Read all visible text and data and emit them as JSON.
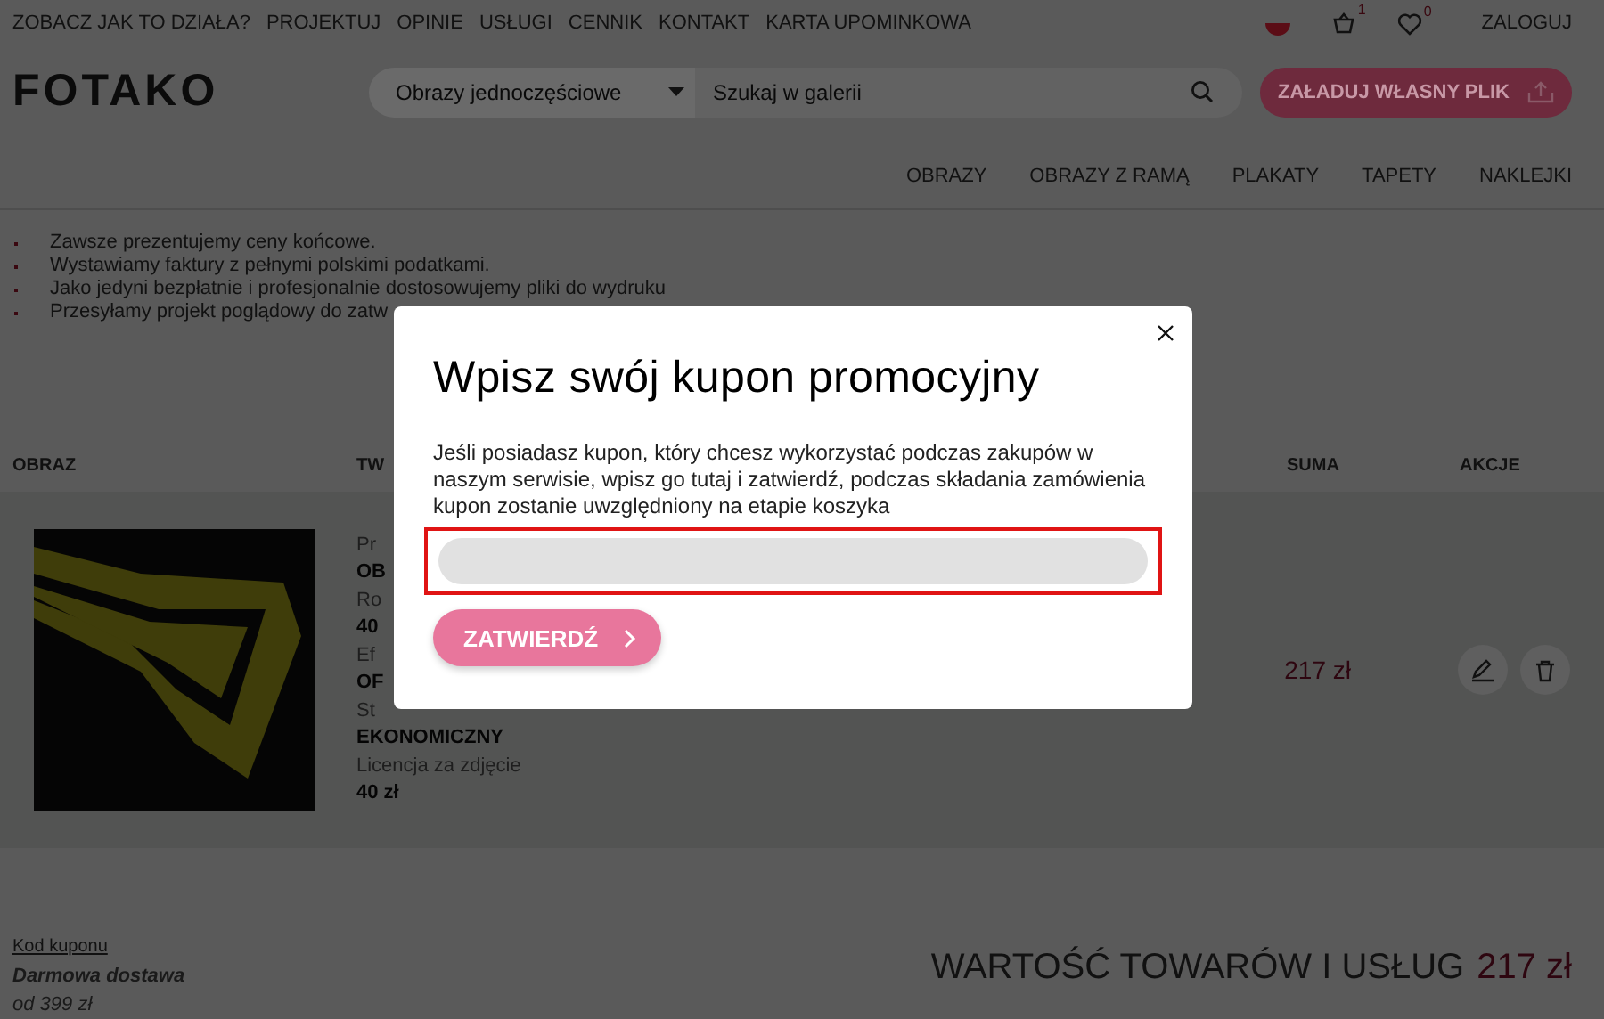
{
  "top_nav": {
    "links": [
      "ZOBACZ JAK TO DZIAŁA?",
      "PROJEKTUJ",
      "OPINIE",
      "USŁUGI",
      "CENNIK",
      "KONTAKT",
      "KARTA UPOMINKOWA"
    ],
    "cart_count": "1",
    "wishlist_count": "0",
    "login": "ZALOGUJ"
  },
  "header": {
    "logo": "FOTAKO",
    "category_select": "Obrazy jednoczęściowe",
    "search": {
      "placeholder": "Szukaj w galerii"
    },
    "upload_button": "ZAŁADUJ WŁASNY PLIK"
  },
  "category_nav": [
    "OBRAZY",
    "OBRAZY Z RAMĄ",
    "PLAKATY",
    "TAPETY",
    "NAKLEJKI"
  ],
  "benefits": [
    "Zawsze prezentujemy ceny końcowe.",
    "Wystawiamy faktury z pełnymi polskimi podatkami.",
    "Jako jedyni bezpłatnie i profesjonalnie dostosowujemy pliki do wydruku",
    "Przesyłamy projekt poglądowy do zatw"
  ],
  "cart_table": {
    "columns": [
      "OBRAZ",
      "TW",
      "SUMA",
      "AKCJE"
    ],
    "rows": [
      {
        "details": [
          {
            "label": "Pr",
            "value": "OB"
          },
          {
            "label": "Ro",
            "value": "40"
          },
          {
            "label": "Ef",
            "value": "OF"
          },
          {
            "label": "St",
            "value": "EKONOMICZNY"
          },
          {
            "label": "Licencja za zdjęcie",
            "value": "40 zł"
          }
        ],
        "sum": "217 zł"
      }
    ]
  },
  "coupon_link": "Kod kuponu",
  "free_shipping": "Darmowa dostawa",
  "free_shipping_threshold": "od 399 zł",
  "total": {
    "label": "WARTOŚĆ TOWARÓW I USŁUG",
    "value": "217 zł"
  },
  "modal": {
    "title": "Wpisz swój kupon promocyjny",
    "text": "Jeśli posiadasz kupon, który chcesz wykorzystać podczas zakupów w naszym serwisie, wpisz go tutaj i zatwierdź, podczas składania zamówienia kupon zostanie uwzględniony na etapie koszyka",
    "input": {
      "highlighted": true
    },
    "submit": "ZATWIERDŹ"
  }
}
